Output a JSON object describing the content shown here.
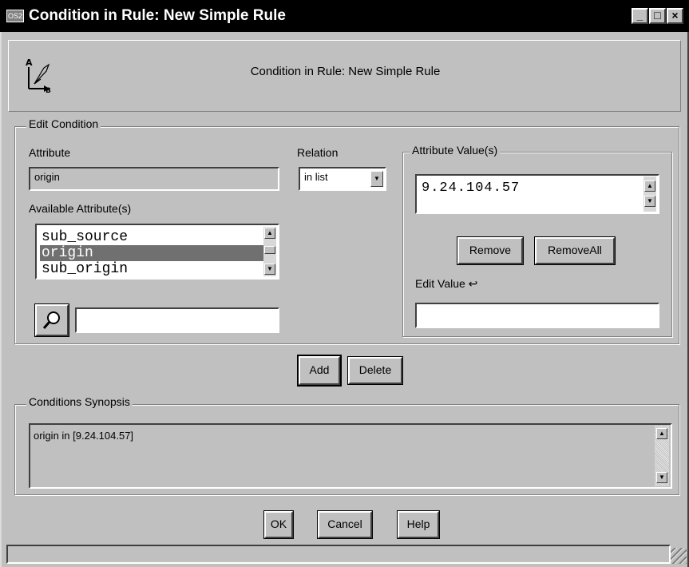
{
  "window": {
    "title": "Condition in Rule: New Simple Rule",
    "icon_label": "OS2",
    "controls": {
      "minimize": "_",
      "maximize": "□",
      "close": "×"
    }
  },
  "header": {
    "title": "Condition in Rule: New Simple Rule",
    "icon": "attribute-arrow-icon"
  },
  "edit_condition": {
    "legend": "Edit Condition",
    "attribute_label": "Attribute",
    "attribute_value": "origin",
    "available_label": "Available Attribute(s)",
    "available": [
      "sub_source",
      "origin",
      "sub_origin"
    ],
    "selected_index": 1,
    "search_value": "",
    "relation_label": "Relation",
    "relation_value": "in list",
    "values_legend": "Attribute Value(s)",
    "values": [
      "9.24.104.57"
    ],
    "remove_label": "Remove",
    "remove_all_label": "RemoveAll",
    "edit_value_label": "Edit Value",
    "edit_value": ""
  },
  "actions": {
    "add_label": "Add",
    "delete_label": "Delete"
  },
  "synopsis": {
    "legend": "Conditions Synopsis",
    "text": "origin in [9.24.104.57]"
  },
  "footer": {
    "ok_label": "OK",
    "cancel_label": "Cancel",
    "help_label": "Help"
  },
  "colors": {
    "face": "#c0c0c0",
    "selection": "#707070",
    "titlebar": "#000000"
  }
}
